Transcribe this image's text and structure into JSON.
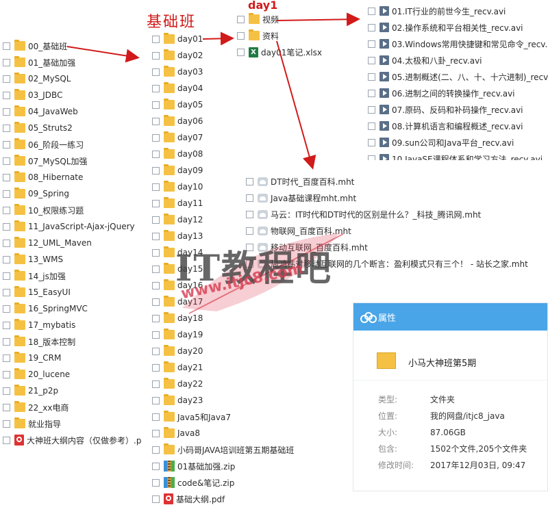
{
  "labels": {
    "jichuban": "基础班",
    "day1": "day1"
  },
  "left_list": [
    "00_基础班",
    "01_基础加强",
    "02_MySQL",
    "03_JDBC",
    "04_JavaWeb",
    "05_Struts2",
    "06_阶段一练习",
    "07_MySQL加强",
    "08_Hibernate",
    "09_Spring",
    "10_权限练习题",
    "11_JavaScript-Ajax-jQuery",
    "12_UML_Maven",
    "13_WMS",
    "14_js加强",
    "15_EasyUI",
    "16_SpringMVC",
    "17_mybatis",
    "18_版本控制",
    "19_CRM",
    "20_lucene",
    "21_p2p",
    "22_xx电商",
    "就业指导",
    "大神班大纲内容（仅做参考）.p"
  ],
  "mid_list": [
    "day01",
    "day02",
    "day03",
    "day04",
    "day05",
    "day06",
    "day07",
    "day08",
    "day09",
    "day10",
    "day11",
    "day12",
    "day13",
    "day14",
    "day15",
    "day16",
    "day17",
    "day18",
    "day19",
    "day20",
    "day21",
    "day22",
    "day23",
    "Java5和Java7",
    "Java8",
    "小码哥JAVA培训班第五期基础班",
    "01基础加强.zip",
    "code&笔记.zip",
    "基础大纲.pdf"
  ],
  "day_list": [
    "视频",
    "资料",
    "day01笔记.xlsx"
  ],
  "video_list": [
    "01.IT行业的前世今生_recv.avi",
    "02.操作系统和平台相关性_recv.avi",
    "03.Windows常用快捷键和常见命令_recv.avi",
    "04.太极和八卦_recv.avi",
    "05.进制概述(二、八、十、十六进制)_recv.avi",
    "06.进制之间的转换操作_recv.avi",
    "07.原码、反码和补码操作_recv.avi",
    "08.计算机语言和编程概述_recv.avi",
    "09.sun公司和Java平台_recv.avi",
    "10.JavaSE课程体系和学习方法_recv.avi"
  ],
  "material_list": [
    "DT时代_百度百科.mht",
    "Java基础课程mht.mht",
    "马云：IT时代和DT时代的区别是什么？_科技_腾讯网.mht",
    "物联网_百度百科.mht",
    "移动互联网_百度百科.mht",
    "周鸿祎对移动互联网的几个断言：盈利模式只有三个！ - 站长之家.mht"
  ],
  "props": {
    "header": "属性",
    "name": "小马大神班第5期",
    "rows": [
      {
        "k": "类型:",
        "v": "文件夹"
      },
      {
        "k": "位置:",
        "v": "我的网盘/itjc8_java"
      },
      {
        "k": "大小:",
        "v": "87.06GB"
      },
      {
        "k": "包含:",
        "v": "1502个文件,205个文件夹"
      },
      {
        "k": "修改时间:",
        "v": "2017年12月03日, 09:47"
      }
    ]
  },
  "watermark": {
    "line1": "IT教程吧",
    "line2": "www.itjc8.com"
  },
  "colors": {
    "accent": "#49a5e8",
    "arrow": "#d11a1a",
    "folder": "#f5c144"
  }
}
